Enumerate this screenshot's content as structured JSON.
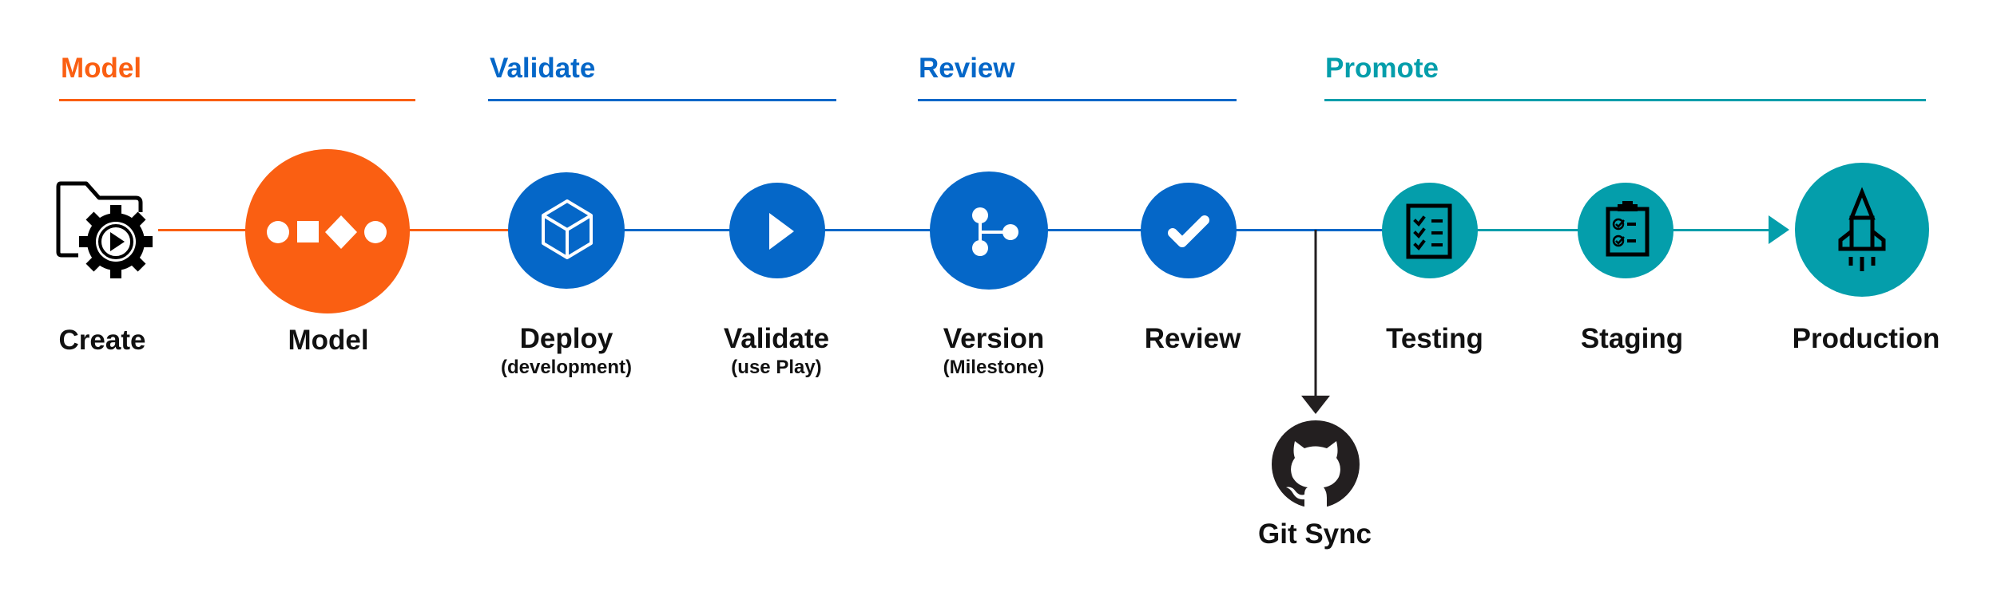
{
  "colors": {
    "model": "#FA5F12",
    "validate": "#0567C8",
    "review": "#0567C8",
    "promote": "#049EAB",
    "ink": "#231F20",
    "icon_light": "#FFFFFF",
    "icon_dark": "#000000"
  },
  "phases": [
    {
      "id": "model",
      "title": "Model"
    },
    {
      "id": "validate",
      "title": "Validate"
    },
    {
      "id": "review",
      "title": "Review"
    },
    {
      "id": "promote",
      "title": "Promote"
    }
  ],
  "steps": [
    {
      "id": "create",
      "label": "Create",
      "sublabel": "",
      "icon": "folder-gear-play-icon",
      "phase": "model"
    },
    {
      "id": "model",
      "label": "Model",
      "sublabel": "",
      "icon": "shapes-icon",
      "phase": "model"
    },
    {
      "id": "deploy",
      "label": "Deploy",
      "sublabel": "(development)",
      "icon": "cube-icon",
      "phase": "validate"
    },
    {
      "id": "validate",
      "label": "Validate",
      "sublabel": "(use Play)",
      "icon": "play-icon",
      "phase": "validate"
    },
    {
      "id": "version",
      "label": "Version",
      "sublabel": "(Milestone)",
      "icon": "branch-icon",
      "phase": "review"
    },
    {
      "id": "review",
      "label": "Review",
      "sublabel": "",
      "icon": "checkmark-icon",
      "phase": "review"
    },
    {
      "id": "testing",
      "label": "Testing",
      "sublabel": "",
      "icon": "checklist-icon",
      "phase": "promote"
    },
    {
      "id": "staging",
      "label": "Staging",
      "sublabel": "",
      "icon": "clipboard-check-icon",
      "phase": "promote"
    },
    {
      "id": "production",
      "label": "Production",
      "sublabel": "",
      "icon": "rocket-icon",
      "phase": "promote"
    }
  ],
  "branch": {
    "label": "Git Sync",
    "icon": "github-icon"
  }
}
